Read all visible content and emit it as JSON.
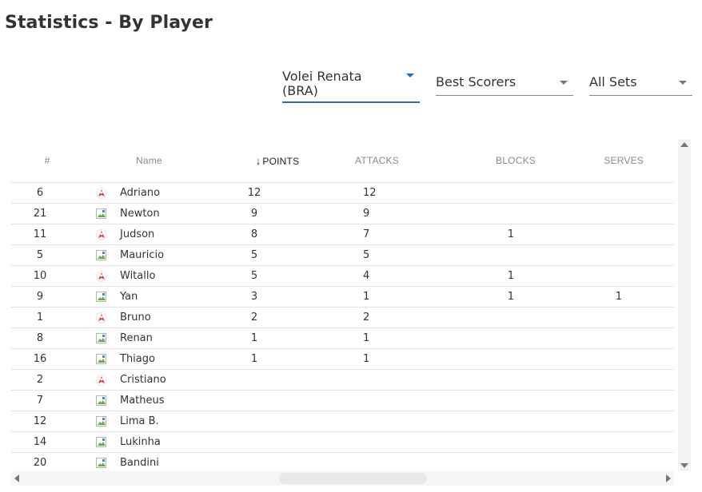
{
  "page": {
    "title": "Statistics - By Player"
  },
  "filters": {
    "team": "Volei Renata\n(BRA)",
    "stat": "Best Scorers",
    "sets": "All Sets"
  },
  "table": {
    "columns": {
      "number": "#",
      "name": "Name",
      "points": "POINTS",
      "attacks": "ATTACKS",
      "blocks": "BLOCKS",
      "serves": "SERVES"
    },
    "sort_arrow": "↓",
    "rows": [
      {
        "number": "6",
        "name": "Adriano",
        "points": "12",
        "attacks": "12",
        "blocks": "",
        "serves": "",
        "avatar": "loaded"
      },
      {
        "number": "21",
        "name": "Newton",
        "points": "9",
        "attacks": "9",
        "blocks": "",
        "serves": "",
        "avatar": "broken"
      },
      {
        "number": "11",
        "name": "Judson",
        "points": "8",
        "attacks": "7",
        "blocks": "1",
        "serves": "",
        "avatar": "loaded"
      },
      {
        "number": "5",
        "name": "Mauricio",
        "points": "5",
        "attacks": "5",
        "blocks": "",
        "serves": "",
        "avatar": "broken"
      },
      {
        "number": "10",
        "name": "Witallo",
        "points": "5",
        "attacks": "4",
        "blocks": "1",
        "serves": "",
        "avatar": "loaded"
      },
      {
        "number": "9",
        "name": "Yan",
        "points": "3",
        "attacks": "1",
        "blocks": "1",
        "serves": "1",
        "avatar": "broken"
      },
      {
        "number": "1",
        "name": "Bruno",
        "points": "2",
        "attacks": "2",
        "blocks": "",
        "serves": "",
        "avatar": "loaded"
      },
      {
        "number": "8",
        "name": "Renan",
        "points": "1",
        "attacks": "1",
        "blocks": "",
        "serves": "",
        "avatar": "broken"
      },
      {
        "number": "16",
        "name": "Thiago",
        "points": "1",
        "attacks": "1",
        "blocks": "",
        "serves": "",
        "avatar": "broken"
      },
      {
        "number": "2",
        "name": "Cristiano",
        "points": "",
        "attacks": "",
        "blocks": "",
        "serves": "",
        "avatar": "loaded"
      },
      {
        "number": "7",
        "name": "Matheus",
        "points": "",
        "attacks": "",
        "blocks": "",
        "serves": "",
        "avatar": "broken"
      },
      {
        "number": "12",
        "name": "Lima B.",
        "points": "",
        "attacks": "",
        "blocks": "",
        "serves": "",
        "avatar": "broken"
      },
      {
        "number": "14",
        "name": "Lukinha",
        "points": "",
        "attacks": "",
        "blocks": "",
        "serves": "",
        "avatar": "broken"
      },
      {
        "number": "20",
        "name": "Bandini",
        "points": "",
        "attacks": "",
        "blocks": "",
        "serves": "",
        "avatar": "broken"
      }
    ]
  },
  "colors": {
    "accent": "#1d6fb8",
    "avatar_red": "#d9342b"
  }
}
